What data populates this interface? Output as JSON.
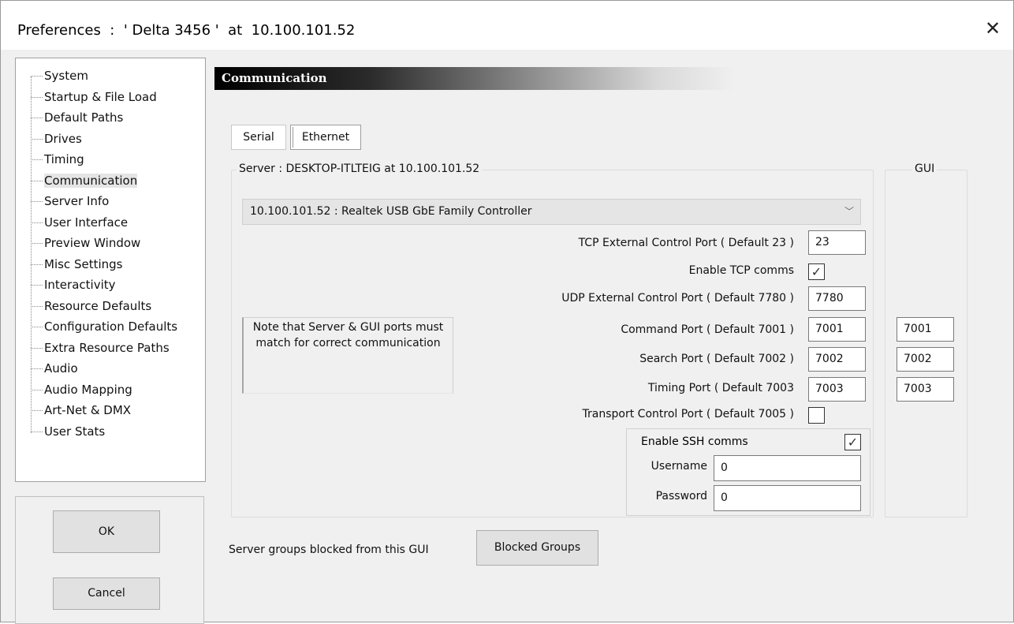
{
  "window": {
    "title": "Preferences  :  ' Delta 3456 '  at  10.100.101.52",
    "close_glyph": "✕"
  },
  "tree": {
    "items": [
      {
        "label": "System"
      },
      {
        "label": "Startup & File Load"
      },
      {
        "label": "Default Paths"
      },
      {
        "label": "Drives"
      },
      {
        "label": "Timing"
      },
      {
        "label": "Communication"
      },
      {
        "label": "Server Info"
      },
      {
        "label": "User Interface"
      },
      {
        "label": "Preview Window"
      },
      {
        "label": "Misc Settings"
      },
      {
        "label": "Interactivity"
      },
      {
        "label": "Resource Defaults"
      },
      {
        "label": "Configuration Defaults"
      },
      {
        "label": "Extra Resource Paths"
      },
      {
        "label": "Audio"
      },
      {
        "label": "Audio Mapping"
      },
      {
        "label": "Art-Net & DMX"
      },
      {
        "label": "User Stats"
      }
    ],
    "selected": "Communication"
  },
  "buttons": {
    "ok": "OK",
    "cancel": "Cancel"
  },
  "panel": {
    "header": "Communication",
    "tabs": [
      "Serial",
      "Ethernet"
    ],
    "active_tab": "Ethernet",
    "server_group_label": "Server : DESKTOP-ITLTEIG  at  10.100.101.52",
    "gui_group_label": "GUI",
    "adapter": {
      "selected": "10.100.101.52 : Realtek USB GbE Family Controller",
      "chevron": "﹀"
    },
    "note": "Note that Server & GUI ports must match for correct communication",
    "fields": {
      "tcp_port_label": "TCP External Control Port ( Default 23 )",
      "tcp_port_value": "23",
      "enable_tcp_label": "Enable TCP comms",
      "enable_tcp_checked": true,
      "udp_port_label": "UDP External Control Port ( Default 7780 )",
      "udp_port_value": "7780",
      "command_port_label": "Command Port ( Default 7001 )",
      "command_port_server": "7001",
      "command_port_gui": "7001",
      "search_port_label": "Search Port ( Default 7002 )",
      "search_port_server": "7002",
      "search_port_gui": "7002",
      "timing_port_label": "Timing Port ( Default 7003",
      "timing_port_server": "7003",
      "timing_port_gui": "7003",
      "transport_port_label": "Transport Control Port ( Default 7005 )",
      "transport_checked": false
    },
    "ssh": {
      "enable_label": "Enable SSH comms",
      "enable_checked": true,
      "username_label": "Username",
      "username_value": "0",
      "password_label": "Password",
      "password_value": "0"
    },
    "footer": {
      "label": "Server groups blocked from this GUI",
      "button": "Blocked Groups"
    }
  },
  "check_glyph": "✓"
}
